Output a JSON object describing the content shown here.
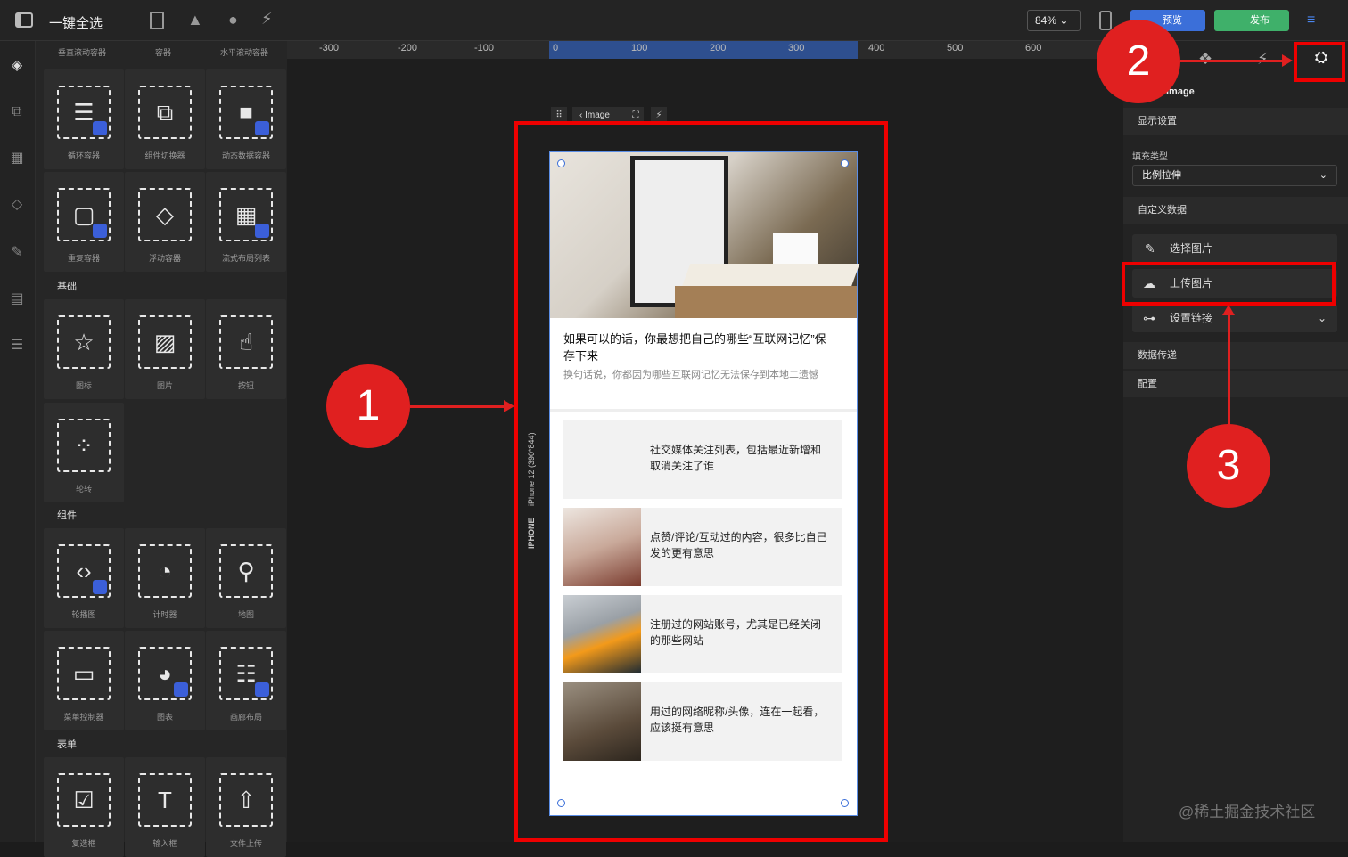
{
  "topbar": {
    "title": "一键全选",
    "zoom": "84%",
    "preview": "预览",
    "publish": "发布"
  },
  "palette": {
    "top_labels": [
      "垂直滚动容器",
      "容器",
      "水平滚动容器"
    ],
    "row1": [
      "循环容器",
      "组件切换器",
      "动态数据容器"
    ],
    "row2": [
      "重复容器",
      "浮动容器",
      "流式布局列表"
    ],
    "section_basic": "基础",
    "basic": [
      "图标",
      "图片",
      "按钮"
    ],
    "basic2": [
      "轮转"
    ],
    "section_components": "组件",
    "components": [
      "轮播图",
      "计时器",
      "地图"
    ],
    "components2": [
      "菜单控制器",
      "图表",
      "画廊布局"
    ],
    "section_form": "表单",
    "form": [
      "复选框",
      "输入框",
      "文件上传"
    ]
  },
  "ruler": [
    "-300",
    "-200",
    "-100",
    "0",
    "100",
    "200",
    "300",
    "400",
    "500",
    "600"
  ],
  "device": {
    "label1": "iPhone 12 (390*844)",
    "label2": "IPHONE",
    "toolbar_label": "Image"
  },
  "phone": {
    "headline": "如果可以的话，你最想把自己的哪些“互联网记忆”保存下来",
    "sub": "换句话说，你都因为哪些互联网记忆无法保存到本地二遗憾",
    "items": [
      "社交媒体关注列表，包括最近新增和取消关注了谁",
      "点赞/评论/互动过的内容，很多比自己发的更有意思",
      "注册过的网站账号，尤其是已经关闭的那些网站",
      "用过的网络昵称/头像，连在一起看，应该挺有意思"
    ]
  },
  "right": {
    "title": "Image",
    "display": "显示设置",
    "fill_label": "填充类型",
    "fill_value": "比例拉伸",
    "custom": "自定义数据",
    "choose": "选择图片",
    "upload": "上传图片",
    "link": "设置链接",
    "data": "数据传递",
    "config": "配置"
  },
  "badges": [
    "1",
    "2",
    "3"
  ],
  "watermark": "@稀土掘金技术社区",
  "colors": {
    "accent": "#3b6fd9",
    "publish": "#3fb06a",
    "annotation": "#e00000"
  }
}
